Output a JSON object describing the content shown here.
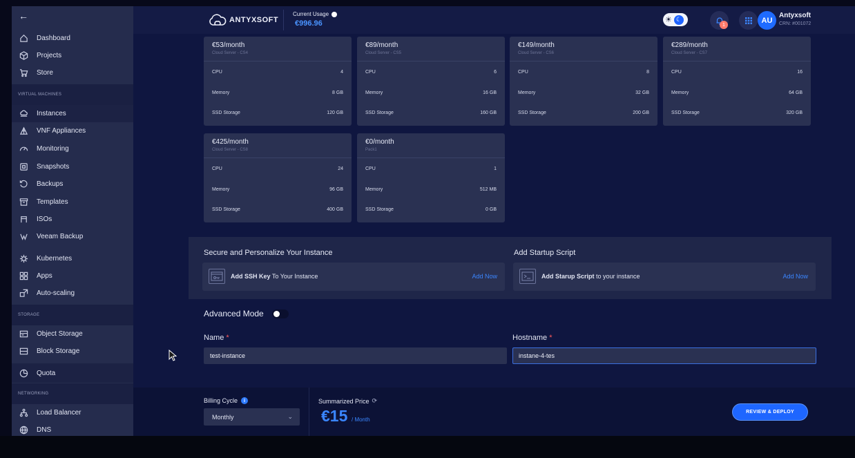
{
  "sidebar": {
    "back_label": "←",
    "items_top": [
      {
        "label": "Dashboard",
        "icon": "home-icon"
      },
      {
        "label": "Projects",
        "icon": "cube-icon"
      },
      {
        "label": "Store",
        "icon": "cart-icon"
      }
    ],
    "section_vm": "VIRTUAL MACHINES",
    "items_vm": [
      {
        "label": "Instances",
        "icon": "cloud-stack-icon",
        "active": true
      },
      {
        "label": "VNF Appliances",
        "icon": "network-icon"
      },
      {
        "label": "Monitoring",
        "icon": "gauge-icon"
      },
      {
        "label": "Snapshots",
        "icon": "camera-icon"
      },
      {
        "label": "Backups",
        "icon": "history-icon"
      },
      {
        "label": "Templates",
        "icon": "archive-icon"
      },
      {
        "label": "ISOs",
        "icon": "disc-icon"
      },
      {
        "label": "Veeam Backup",
        "icon": "veeam-icon"
      }
    ],
    "items_apps": [
      {
        "label": "Kubernetes",
        "icon": "helm-icon"
      },
      {
        "label": "Apps",
        "icon": "grid-icon"
      },
      {
        "label": "Auto-scaling",
        "icon": "scale-icon"
      }
    ],
    "section_storage": "STORAGE",
    "items_storage": [
      {
        "label": "Object Storage",
        "icon": "bucket-icon"
      },
      {
        "label": "Block Storage",
        "icon": "block-icon"
      }
    ],
    "items_quota": [
      {
        "label": "Quota",
        "icon": "pie-icon"
      }
    ],
    "section_net": "NETWORKING",
    "items_net": [
      {
        "label": "Load Balancer",
        "icon": "load-balancer-icon"
      },
      {
        "label": "DNS",
        "icon": "globe-icon"
      }
    ]
  },
  "header": {
    "logo_text": "ANTYXSOFT",
    "usage_label": "Current Usage",
    "usage_value": "€996.96",
    "notif_count": "1",
    "avatar_initials": "AU",
    "user_name": "Antyxsoft",
    "user_crn": "CRN: #001072"
  },
  "plans": [
    {
      "price": "€53/month",
      "name": "Cloud Server - CS4",
      "cpu": "4",
      "memory": "8 GB",
      "ssd": "120 GB"
    },
    {
      "price": "€89/month",
      "name": "Cloud Server - CS5",
      "cpu": "6",
      "memory": "16 GB",
      "ssd": "160 GB"
    },
    {
      "price": "€149/month",
      "name": "Cloud Server - CS6",
      "cpu": "8",
      "memory": "32 GB",
      "ssd": "200 GB"
    },
    {
      "price": "€289/month",
      "name": "Cloud Server - CS7",
      "cpu": "16",
      "memory": "64 GB",
      "ssd": "320 GB"
    },
    {
      "price": "€425/month",
      "name": "Cloud Server - CS8",
      "cpu": "24",
      "memory": "96 GB",
      "ssd": "400 GB"
    },
    {
      "price": "€0/month",
      "name": "Pack1",
      "cpu": "1",
      "memory": "512 MB",
      "ssd": "0 GB"
    }
  ],
  "plan_labels": {
    "cpu": "CPU",
    "memory": "Memory",
    "ssd": "SSD Storage"
  },
  "secure": {
    "title": "Secure and Personalize Your Instance",
    "ssh_bold": "Add SSH Key",
    "ssh_rest": " To Your Instance",
    "ssh_add": "Add Now",
    "startup_title": "Add Startup Script",
    "startup_bold": "Add Starup Script",
    "startup_rest": " to your instance",
    "startup_add": "Add Now"
  },
  "form": {
    "advanced_label": "Advanced Mode",
    "name_label": "Name",
    "name_value": "test-instance",
    "hostname_label": "Hostname",
    "hostname_value": "instane-4-tes",
    "required_mark": "*"
  },
  "footer": {
    "billing_label": "Billing Cycle",
    "billing_info": "i",
    "billing_value": "Monthly",
    "summary_label": "Summarized Price",
    "summary_price": "€15",
    "summary_period": "/ Month",
    "deploy_label": "REVIEW & DEPLOY"
  },
  "colors": {
    "accent": "#1e66ff",
    "price_blue": "#3a86ff",
    "required": "#ff5a5a"
  }
}
